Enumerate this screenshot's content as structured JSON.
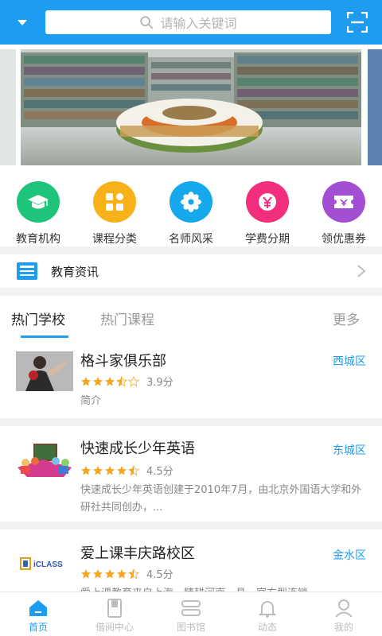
{
  "header": {
    "search_placeholder": "请输入关键词"
  },
  "categories": [
    {
      "label": "教育机构",
      "color": "#1ec47a",
      "icon": "graduation-cap-icon"
    },
    {
      "label": "课程分类",
      "color": "#f7b21a",
      "icon": "grid-icon"
    },
    {
      "label": "名师风采",
      "color": "#16a8ec",
      "icon": "flower-icon"
    },
    {
      "label": "学费分期",
      "color": "#f32f7d",
      "icon": "yuan-icon"
    },
    {
      "label": "领优惠券",
      "color": "#a24fd3",
      "icon": "coupon-icon"
    }
  ],
  "news": {
    "title": "教育资讯"
  },
  "tabs": {
    "active": "热门学校",
    "inactive": "热门课程",
    "more": "更多"
  },
  "schools": [
    {
      "name": "格斗家俱乐部",
      "district": "西城区",
      "score": "3.9分",
      "rating": 3.9,
      "desc": "简介"
    },
    {
      "name": "快速成长少年英语",
      "district": "东城区",
      "score": "4.5分",
      "rating": 4.5,
      "desc": "快速成长少年英语创建于2010年7月，由北京外国语大学和外研社共同创办，..."
    },
    {
      "name": "爱上课丰庆路校区",
      "district": "金水区",
      "score": "4.5分",
      "rating": 4.5,
      "desc": "爱上课教育来自上海，精耕河南一县，官方型连锁"
    }
  ],
  "bottom_nav": [
    {
      "label": "首页",
      "icon": "home-icon",
      "active": true
    },
    {
      "label": "借阅中心",
      "icon": "book-icon",
      "active": false
    },
    {
      "label": "图书馆",
      "icon": "library-icon",
      "active": false
    },
    {
      "label": "动态",
      "icon": "bell-icon",
      "active": false
    },
    {
      "label": "我的",
      "icon": "user-icon",
      "active": false
    }
  ],
  "colors": {
    "brand": "#1e9df0",
    "star": "#f6a623"
  }
}
